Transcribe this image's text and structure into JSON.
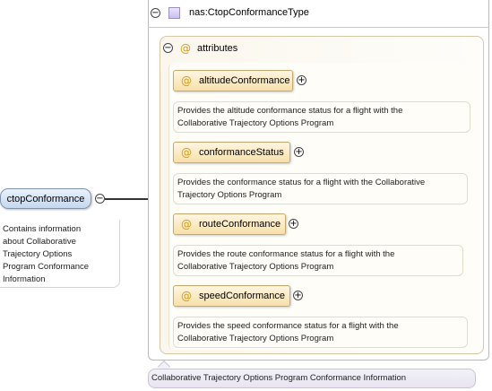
{
  "element": {
    "name": "ctopConformance",
    "documentation": "Contains information\nabout Collaborative\nTrajectory Options\nProgram Conformance\nInformation"
  },
  "type": {
    "name": "nas:CtopConformanceType",
    "documentation": "Collaborative Trajectory Options Program Conformance Information"
  },
  "attributes_group": {
    "label": "attributes",
    "items": [
      {
        "name": "altitudeConformance",
        "documentation": "Provides the altitude conformance status for a flight with the\nCollaborative Trajectory Options Program"
      },
      {
        "name": "conformanceStatus",
        "documentation": "Provides the conformance status for a flight with the Collaborative\nTrajectory Options Program"
      },
      {
        "name": "routeConformance",
        "documentation": "Provides the route conformance status for a flight with the\nCollaborative Trajectory Options Program"
      },
      {
        "name": "speedConformance",
        "documentation": "Provides the speed conformance status for a flight with the\nCollaborative Trajectory Options Program"
      }
    ]
  },
  "symbols": {
    "collapse": "−",
    "expand": "+",
    "attribute": "@"
  },
  "icons": {
    "type_icon": "complex-type-icon",
    "attribute_icon": "attribute-icon",
    "collapse_icon": "collapse-icon",
    "expand_icon": "expand-icon"
  },
  "colors": {
    "element_fill": "#c5d7ee",
    "attribute_fill": "#f7dfa8",
    "attribute_symbol": "#d39a1e",
    "type_icon_fill": "#c8bff0"
  }
}
